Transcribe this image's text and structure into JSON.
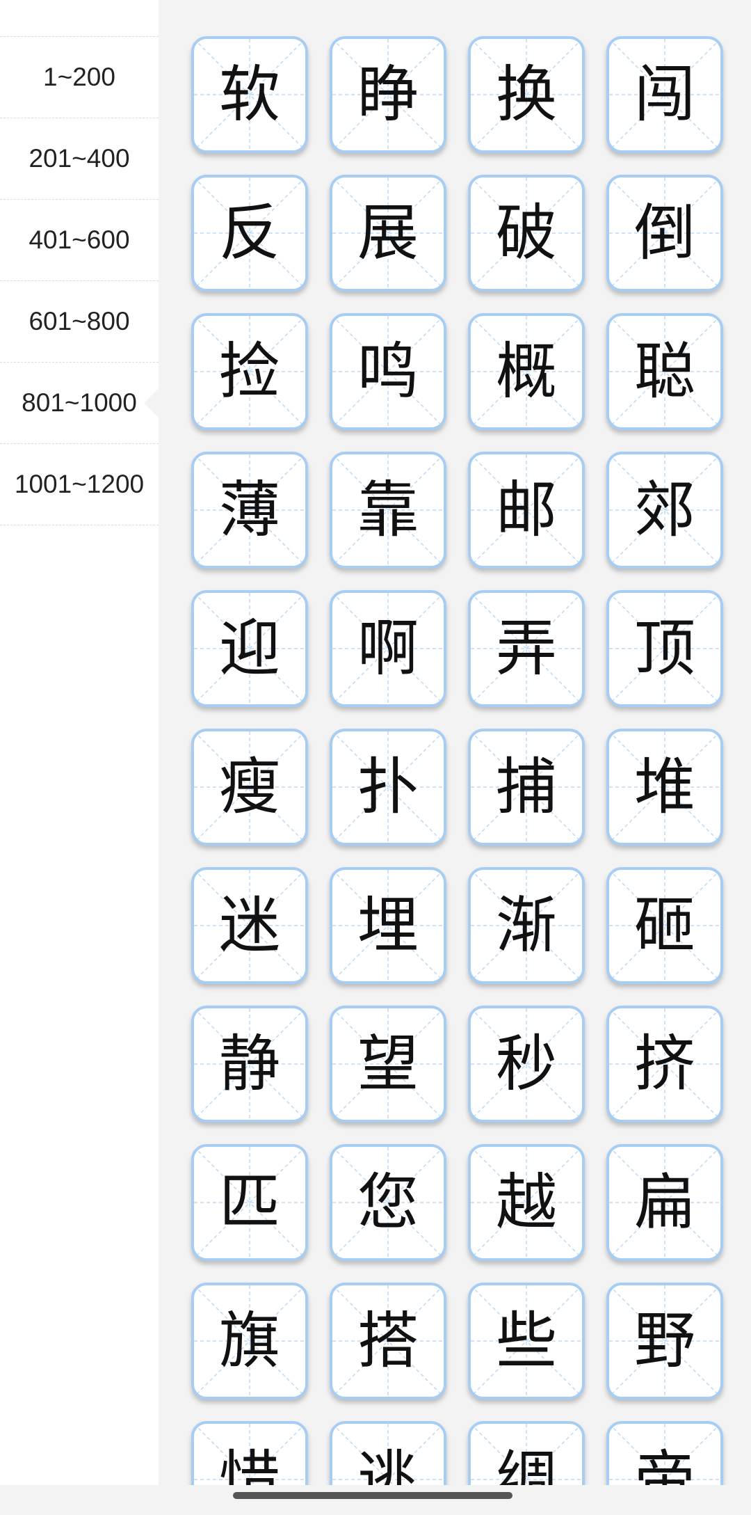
{
  "sidebar": {
    "ranges": [
      "1~200",
      "201~400",
      "401~600",
      "601~800",
      "801~1000",
      "1001~1200"
    ],
    "selected_index": 4
  },
  "characters": [
    "软",
    "睁",
    "换",
    "闯",
    "反",
    "展",
    "破",
    "倒",
    "捡",
    "鸣",
    "概",
    "聪",
    "薄",
    "靠",
    "邮",
    "郊",
    "迎",
    "啊",
    "弄",
    "顶",
    "瘦",
    "扑",
    "捕",
    "堆",
    "迷",
    "埋",
    "渐",
    "砸",
    "静",
    "望",
    "秒",
    "挤",
    "匹",
    "您",
    "越",
    "扁",
    "旗",
    "搭",
    "些",
    "野",
    "惜",
    "逃",
    "绸",
    "帝"
  ],
  "colors": {
    "card_border": "#a8cdf3",
    "guide_lines": "#a8cdf3",
    "page_background": "#f3f3f4",
    "sidebar_background": "#ffffff"
  }
}
